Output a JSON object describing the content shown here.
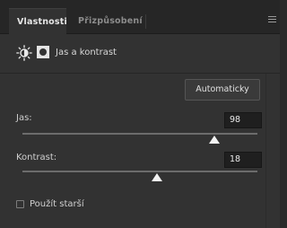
{
  "tabs": [
    {
      "label": "Vlastnosti",
      "active": true
    },
    {
      "label": "Přizpůsobení",
      "active": false
    }
  ],
  "header": {
    "title": "Jas a kontrast",
    "icons": [
      "brightness-sun-icon",
      "layer-mask-icon"
    ]
  },
  "auto_button": {
    "label": "Automaticky"
  },
  "controls": {
    "brightness": {
      "label": "Jas:",
      "value": "98",
      "slider_fraction": 0.818
    },
    "contrast": {
      "label": "Kontrast:",
      "value": "18",
      "slider_fraction": 0.574
    }
  },
  "legacy": {
    "label": "Použít starší",
    "checked": false
  },
  "colors": {
    "panel": "#323232",
    "tabbar": "#262626",
    "field": "#1f1f1f",
    "accent_text": "#e6e6e6"
  }
}
